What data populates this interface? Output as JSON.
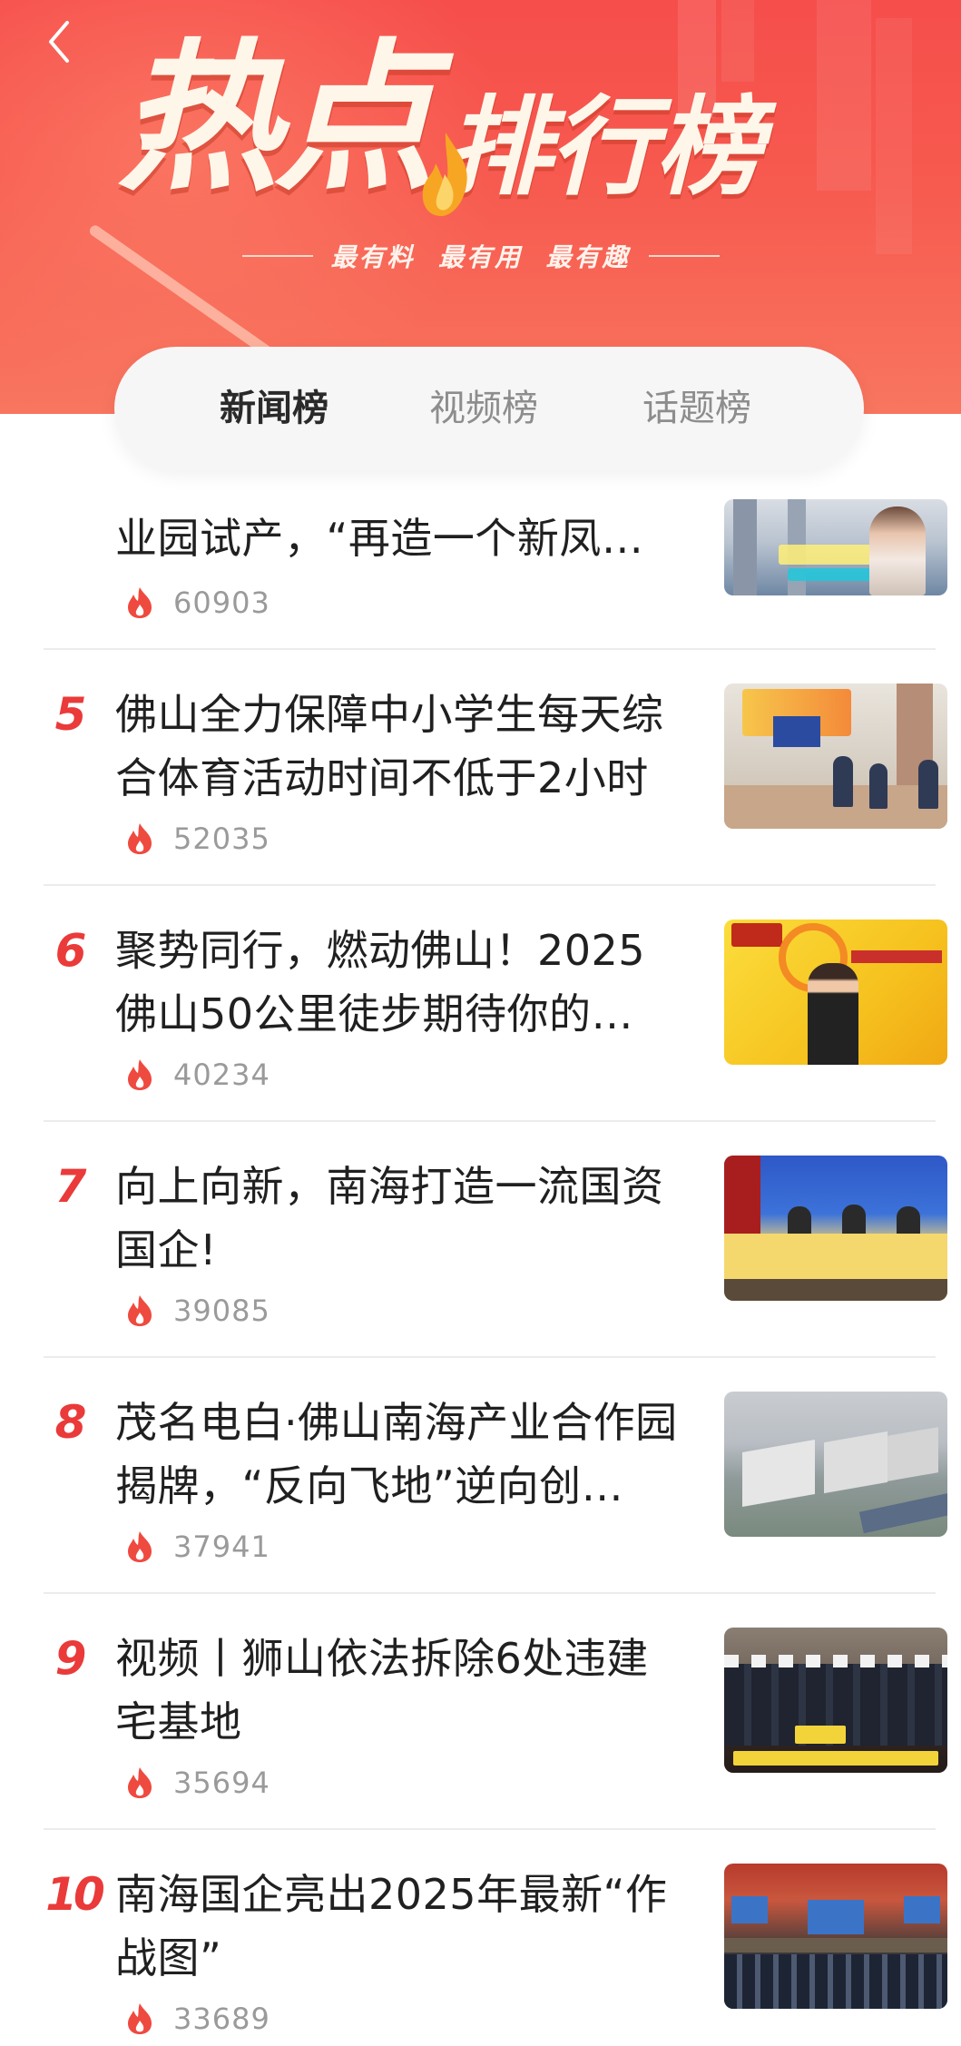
{
  "header": {
    "title_part1": "热点",
    "title_part2": "排行榜",
    "slogan": "最有料  最有用  最有趣",
    "back_icon": "chevron-left-icon"
  },
  "tabs": [
    {
      "label": "新闻榜",
      "active": true
    },
    {
      "label": "视频榜",
      "active": false
    },
    {
      "label": "话题榜",
      "active": false
    }
  ],
  "colors": {
    "accent": "#ea3a3a",
    "banner": "#f64e4b",
    "count_text": "#9a9a9a"
  },
  "items": [
    {
      "rank": "",
      "title": "业园试产，“再造一个新凤…",
      "count": "60903",
      "icon": "flame-icon"
    },
    {
      "rank": "5",
      "title": "佛山全力保障中小学生每天综合体育活动时间不低于2小时",
      "count": "52035",
      "icon": "flame-icon"
    },
    {
      "rank": "6",
      "title": "聚势同行，燃动佛山！2025佛山50公里徒步期待你的…",
      "count": "40234",
      "icon": "flame-icon"
    },
    {
      "rank": "7",
      "title": "向上向新，南海打造一流国资国企!",
      "count": "39085",
      "icon": "flame-icon"
    },
    {
      "rank": "8",
      "title": "茂名电白·佛山南海产业合作园揭牌，“反向飞地”逆向创…",
      "count": "37941",
      "icon": "flame-icon"
    },
    {
      "rank": "9",
      "title": "视频丨狮山依法拆除6处违建宅基地",
      "count": "35694",
      "icon": "flame-icon"
    },
    {
      "rank": "10",
      "title": "南海国企亮出2025年最新“作战图”",
      "count": "33689",
      "icon": "flame-icon"
    }
  ]
}
